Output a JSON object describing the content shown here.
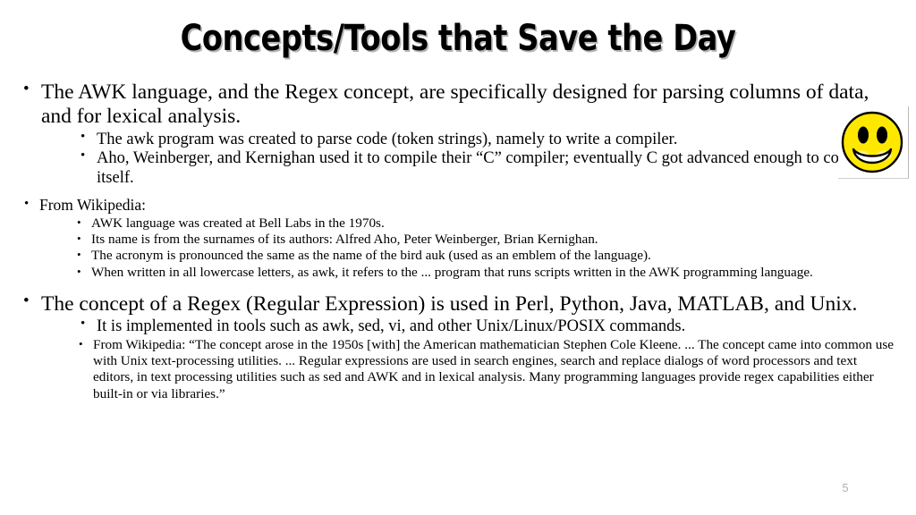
{
  "slide": {
    "title": "Concepts/Tools that Save the Day",
    "page_number": "5"
  },
  "content": {
    "bullet1": {
      "text": "The AWK language, and the Regex concept, are specifically designed for parsing columns of data, and for lexical analysis.",
      "sub": [
        "The awk program was created to parse code (token strings), namely to write a compiler.",
        "Aho, Weinberger, and Kernighan used it to compile their “C” compiler; eventually C got advanced enough to compile itself."
      ]
    },
    "bullet2": {
      "text": "From Wikipedia:",
      "sub": [
        "AWK language was created at Bell Labs in the 1970s.",
        "Its name is from the surnames of its authors: Alfred Aho, Peter Weinberger, Brian Kernighan.",
        "The acronym is pronounced the same as the name of the bird auk (used as an emblem of the language).",
        "When written in all lowercase letters, as awk, it refers to the ... program that runs scripts written in the AWK programming language."
      ]
    },
    "bullet3": {
      "text": "The concept of a Regex (Regular Expression) is used in Perl, Python, Java, MATLAB, and Unix.",
      "sub": [
        "It is implemented in tools such as awk, sed, vi, and other Unix/Linux/POSIX commands.",
        "From Wikipedia: “The concept arose in the 1950s [with] the American mathematician Stephen Cole Kleene. ... The concept came into common use with Unix text-processing utilities.  ...  Regular expressions are used in search engines, search and replace dialogs of word processors and text editors, in text processing utilities such as sed and AWK and in lexical analysis. Many programming languages provide regex capabilities either built-in or via libraries.”"
      ]
    }
  },
  "image": {
    "alt": "smiley-face",
    "face_color": "#FFE800",
    "outline_color": "#000000",
    "cheek_color": "#FFFFFF"
  }
}
